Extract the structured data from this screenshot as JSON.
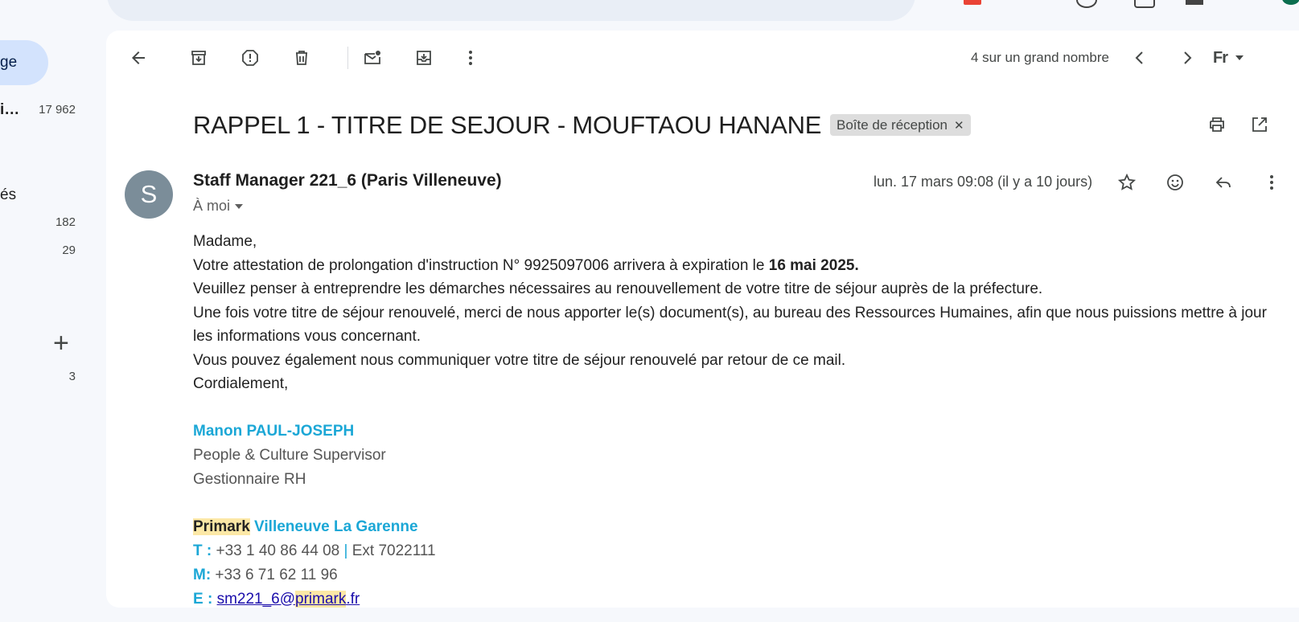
{
  "sidebar": {
    "active_label": "ge",
    "items": [
      {
        "label": "i…",
        "count": "17 962"
      },
      {
        "label": "és",
        "count": ""
      },
      {
        "label": "",
        "count": "182"
      },
      {
        "label": "",
        "count": "29"
      },
      {
        "label": "",
        "count": "3"
      }
    ],
    "add_icon": "plus-icon"
  },
  "toolbar": {
    "icons": [
      "back-arrow-icon",
      "archive-icon",
      "report-spam-icon",
      "delete-icon",
      "mark-unread-icon",
      "move-to-icon",
      "more-vert-icon"
    ],
    "pager_text": "4 sur un grand nombre",
    "input_tool_label": "Fr"
  },
  "message": {
    "subject": "RAPPEL 1 - TITRE DE SEJOUR - MOUFTAOU HANANE",
    "label_chip": "Boîte de réception",
    "avatar_letter": "S",
    "sender": "Staff Manager 221_6 (Paris Villeneuve)",
    "to_me": "À moi",
    "date": "lun. 17 mars 09:08 (il y a 10 jours)",
    "body": {
      "greeting": "Madame,",
      "line1_prefix": "Votre attestation de prolongation d'instruction N° 9925097006 arrivera à expiration le ",
      "line1_bold": "16 mai 2025.",
      "line2": "Veuillez penser à entreprendre les démarches nécessaires au renouvellement de votre titre de séjour auprès de la préfecture.",
      "line3": "Une fois votre titre de séjour renouvelé, merci de nous apporter le(s) document(s), au bureau des Ressources Humaines, afin que nous puissions mettre à jour les informations vous concernant.",
      "line4": "Vous pouvez également nous communiquer votre titre de séjour renouvelé par retour de ce mail.",
      "closing": "Cordialement,"
    },
    "signature": {
      "name": "Manon PAUL-JOSEPH",
      "title1": "People & Culture Supervisor",
      "title2": "Gestionnaire RH",
      "company_hl": "Primark",
      "company_rest": " Villeneuve La Garenne",
      "t_label": "T  :",
      "t_value": " +33 1 40 86 44 08 ",
      "t_sep": "|",
      "t_ext": " Ext 7022111",
      "m_label": "M:",
      "m_value": " +33 6 71 62 11 96",
      "e_label": "E  :",
      "e_pre": "sm221_6@",
      "e_hl": "primark",
      "e_post": ".fr"
    }
  },
  "colors": {
    "accent": "#1ba7d6",
    "highlight": "#fce8a6",
    "nav_active": "#d3e3fd",
    "avatar": "#7b8d99"
  }
}
